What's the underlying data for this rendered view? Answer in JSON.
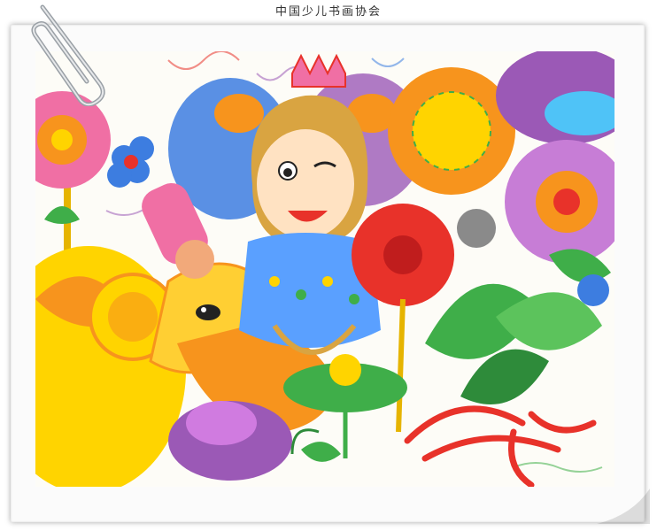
{
  "caption": "中国少儿书画协会",
  "artwork": {
    "colors": {
      "paper": "#fdfcf7",
      "orange": "#f7941d",
      "yellow": "#ffd400",
      "red": "#e8322a",
      "pink": "#f06fa4",
      "purple": "#9b59b6",
      "blue": "#3d7de0",
      "green": "#3fae49",
      "cyan": "#4fc3f7"
    },
    "icons": [
      "paperclip-icon"
    ]
  }
}
